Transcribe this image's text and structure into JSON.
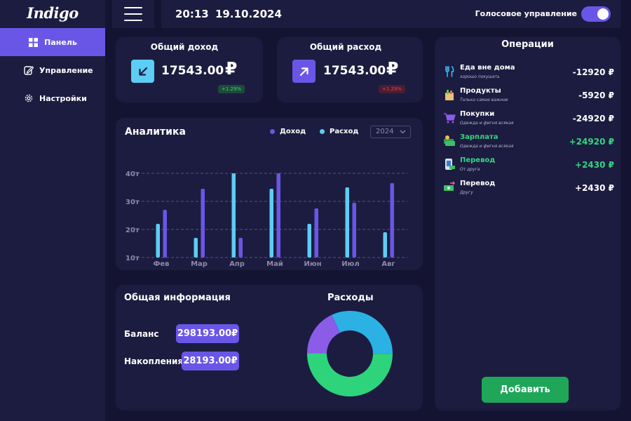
{
  "app": {
    "logo": "Indigo"
  },
  "sidebar": {
    "items": [
      {
        "label": "Панель",
        "icon": "grid-icon",
        "active": true
      },
      {
        "label": "Управление",
        "icon": "edit-icon",
        "active": false
      },
      {
        "label": "Настройки",
        "icon": "gear-icon",
        "active": false
      }
    ]
  },
  "topbar": {
    "time": "20:13",
    "date": "19.10.2024",
    "voice_label": "Голосовое управление",
    "voice_enabled": true
  },
  "income": {
    "title": "Общий доход",
    "amount": "17543.00",
    "currency": "₽",
    "badge": "+1.29%",
    "icon": "arrow-down-left-icon"
  },
  "expense": {
    "title": "Общий расход",
    "amount": "17543.00",
    "currency": "₽",
    "badge": "+1.29%",
    "icon": "arrow-up-right-icon"
  },
  "analytics": {
    "title": "Аналитика",
    "legend": {
      "income": "Доход",
      "expense": "Расход"
    },
    "year": "2024"
  },
  "chart_data": {
    "type": "bar",
    "categories": [
      "Фев",
      "Мар",
      "Апр",
      "Май",
      "Июн",
      "Июл",
      "Авг"
    ],
    "series": [
      {
        "name": "Расход",
        "values": [
          22,
          17,
          40,
          34.5,
          22,
          35,
          19
        ]
      },
      {
        "name": "Доход",
        "values": [
          27,
          34.5,
          17,
          40,
          27.5,
          29.5,
          36.5
        ]
      }
    ],
    "yticks": [
      "10т",
      "20т",
      "30т",
      "40т"
    ],
    "ylim": [
      10,
      40
    ],
    "grid": true,
    "legend_position": "top-right",
    "colors": {
      "Доход": "#6a56e6",
      "Расход": "#5ccdf3"
    }
  },
  "info": {
    "title": "Общая информация",
    "balance_label": "Баланс",
    "balance": "298193.00₽",
    "savings_label": "Накопления",
    "savings": "28193.00₽"
  },
  "expenses_chart": {
    "title": "Расходы",
    "type": "pie",
    "slices": [
      {
        "value": 32,
        "color": "#2bb1e4"
      },
      {
        "value": 50,
        "color": "#2dd47c"
      },
      {
        "value": 18,
        "color": "#8a5ce8"
      }
    ]
  },
  "operations": {
    "title": "Операции",
    "items": [
      {
        "name": "Еда вне дома",
        "sub": "хорошо покушать",
        "amount": "-12920 ₽",
        "icon": "fork-knife-icon",
        "name_color": "#ffffff",
        "amount_color": "#ffffff"
      },
      {
        "name": "Продукты",
        "sub": "Только самое важное",
        "amount": "-5920 ₽",
        "icon": "grocery-bag-icon",
        "name_color": "#ffffff",
        "amount_color": "#ffffff"
      },
      {
        "name": "Покупки",
        "sub": "Одежда и фигня всякая",
        "amount": "-24920 ₽",
        "icon": "shopping-cart-icon",
        "name_color": "#ffffff",
        "amount_color": "#ffffff"
      },
      {
        "name": "Зарплата",
        "sub": "Одежда и фигня всякая",
        "amount": "+24920 ₽",
        "icon": "money-stack-icon",
        "name_color": "#35d47f",
        "amount_color": "#35d47f"
      },
      {
        "name": "Перевод",
        "sub": "От друга",
        "amount": "+2430 ₽",
        "icon": "phone-transfer-icon",
        "name_color": "#35d47f",
        "amount_color": "#35d47f"
      },
      {
        "name": "Перевод",
        "sub": "Другу",
        "amount": "+2430 ₽",
        "icon": "cash-transfer-icon",
        "name_color": "#ffffff",
        "amount_color": "#ffffff"
      }
    ],
    "add_label": "Добавить"
  }
}
